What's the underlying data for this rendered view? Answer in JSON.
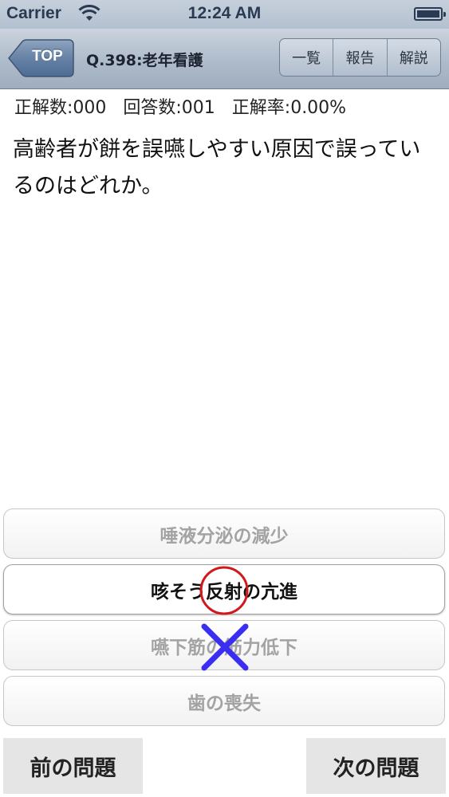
{
  "status_bar": {
    "carrier": "Carrier",
    "time": "12:24 AM"
  },
  "nav": {
    "back_label": "TOP",
    "title": "Q.398:老年看護",
    "segments": [
      "一覧",
      "報告",
      "解説"
    ]
  },
  "stats": {
    "correct": "正解数:000",
    "answered": "回答数:001",
    "rate": "正解率:0.00%"
  },
  "question": "高齢者が餅を誤嚥しやすい原因で誤っているのはどれか。",
  "answers": [
    {
      "label": "唾液分泌の減少"
    },
    {
      "label": "咳そう反射の亢進",
      "mark": "correct-circle"
    },
    {
      "label": "嚥下筋の筋力低下",
      "mark": "wrong-cross"
    },
    {
      "label": "歯の喪失"
    }
  ],
  "marks": {
    "circle_color": "#d0191d",
    "cross_color": "#3a2ef0"
  },
  "footer": {
    "prev_label": "前の問題",
    "next_label": "次の問題"
  }
}
